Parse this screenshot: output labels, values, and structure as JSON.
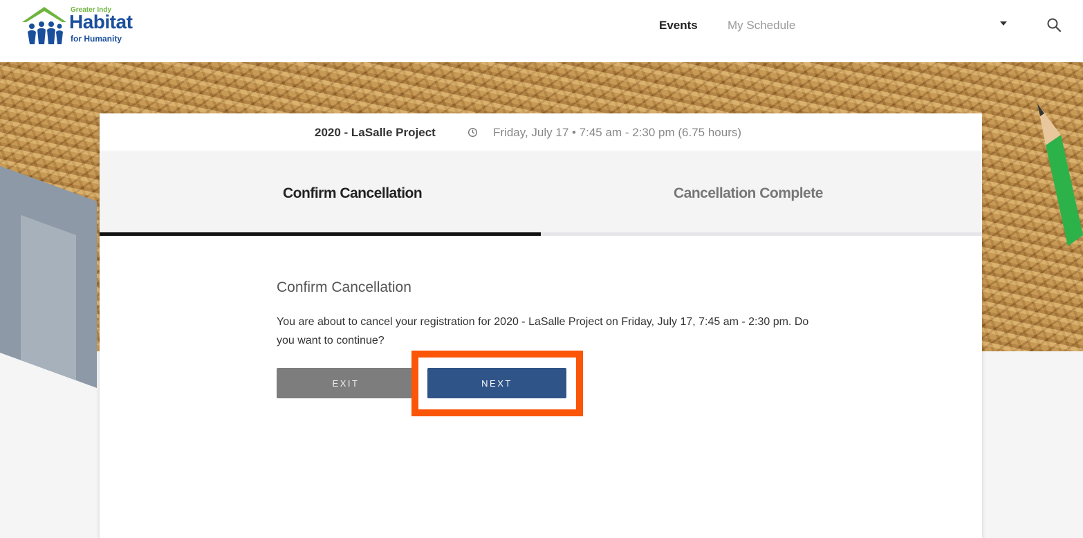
{
  "header": {
    "logo": {
      "small": "Greater Indy",
      "big": "Habitat",
      "sub": "for Humanity"
    },
    "nav": [
      {
        "label": "Events"
      },
      {
        "label": "My Schedule"
      }
    ]
  },
  "event": {
    "name": "2020 - LaSalle Project",
    "time": "Friday, July 17 • 7:45 am - 2:30 pm (6.75 hours)"
  },
  "steps": [
    {
      "label": "Confirm Cancellation",
      "active": true
    },
    {
      "label": "Cancellation Complete",
      "active": false
    }
  ],
  "progress": {
    "current_step": 1,
    "total_steps": 2,
    "fraction": 0.5
  },
  "confirm": {
    "title": "Confirm Cancellation",
    "message": "You are about to cancel your registration for 2020 - LaSalle Project on Friday, July 17, 7:45 am - 2:30 pm. Do you want to continue?"
  },
  "buttons": {
    "exit": "EXIT",
    "next": "NEXT"
  },
  "colors": {
    "primary_button": "#2f5488",
    "exit_button": "#7d7d7d",
    "highlight": "#fb5607",
    "progress": "#111111"
  },
  "icons": {
    "search": "search-icon",
    "clock": "clock-icon",
    "dropdown": "caret-down-icon"
  }
}
